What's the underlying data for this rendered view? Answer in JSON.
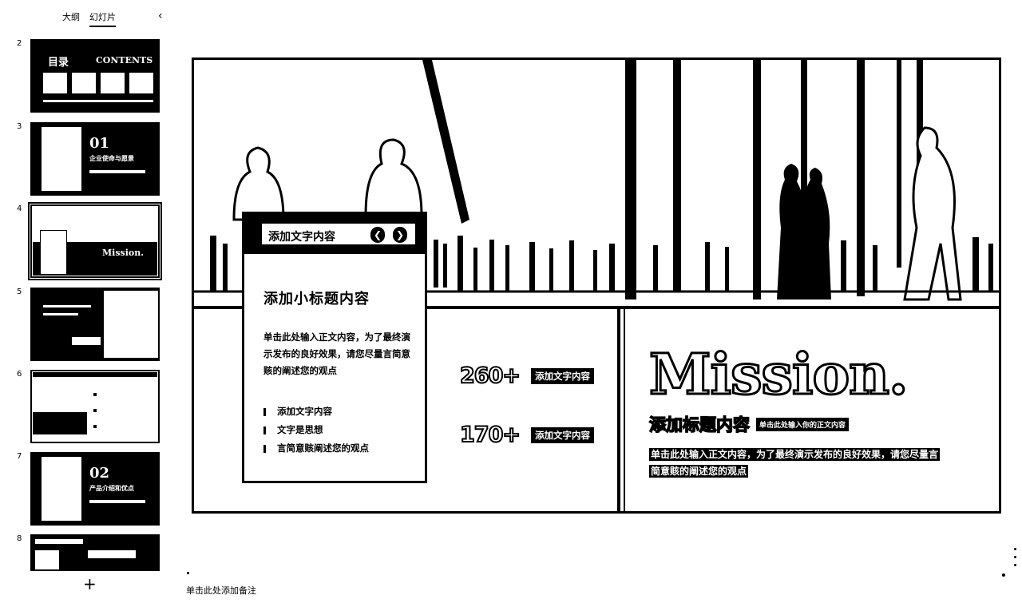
{
  "panel": {
    "tabs": [
      {
        "label": "大纲",
        "active": false
      },
      {
        "label": "幻灯片",
        "active": true
      }
    ],
    "collapse_icon": "chevron-left-icon",
    "add_slide_label": "+"
  },
  "thumbnails": [
    {
      "number": "2",
      "title": "目录",
      "subtitle": "CONTENTS",
      "selected": false
    },
    {
      "number": "3",
      "title": "01",
      "subtitle": "企业使命与愿景",
      "selected": false
    },
    {
      "number": "4",
      "title": "Mission.",
      "subtitle": "",
      "selected": true
    },
    {
      "number": "5",
      "title": "",
      "subtitle": "",
      "selected": false
    },
    {
      "number": "6",
      "title": "",
      "subtitle": "",
      "selected": false
    },
    {
      "number": "7",
      "title": "02",
      "subtitle": "产品介绍和优点",
      "selected": false
    },
    {
      "number": "8",
      "title": "",
      "subtitle": "",
      "selected": false
    }
  ],
  "slide": {
    "card": {
      "header_label": "添加文字内容",
      "prev_icon": "chevron-left-icon",
      "next_icon": "chevron-right-icon",
      "prev_glyph": "❮",
      "next_glyph": "❯",
      "subtitle": "添加小标题内容",
      "body": "单击此处输入正文内容，为了最终演示发布的良好效果，请您尽量言简意赅的阐述您的观点",
      "list": [
        "添加文字内容",
        "文字是思想",
        "言简意赅阐述您的观点"
      ]
    },
    "stats": [
      {
        "value": "260+",
        "label": "添加文字内容"
      },
      {
        "value": "170+",
        "label": "添加文字内容"
      }
    ],
    "mission": "Mission.",
    "title": "添加标题内容",
    "tag": "单击此处输入你的正文内容",
    "body": "单击此处输入正文内容，为了最终演示发布的良好效果，请您尽量言简意赅的阐述您的观点"
  },
  "notes_placeholder": "单击此处添加备注"
}
